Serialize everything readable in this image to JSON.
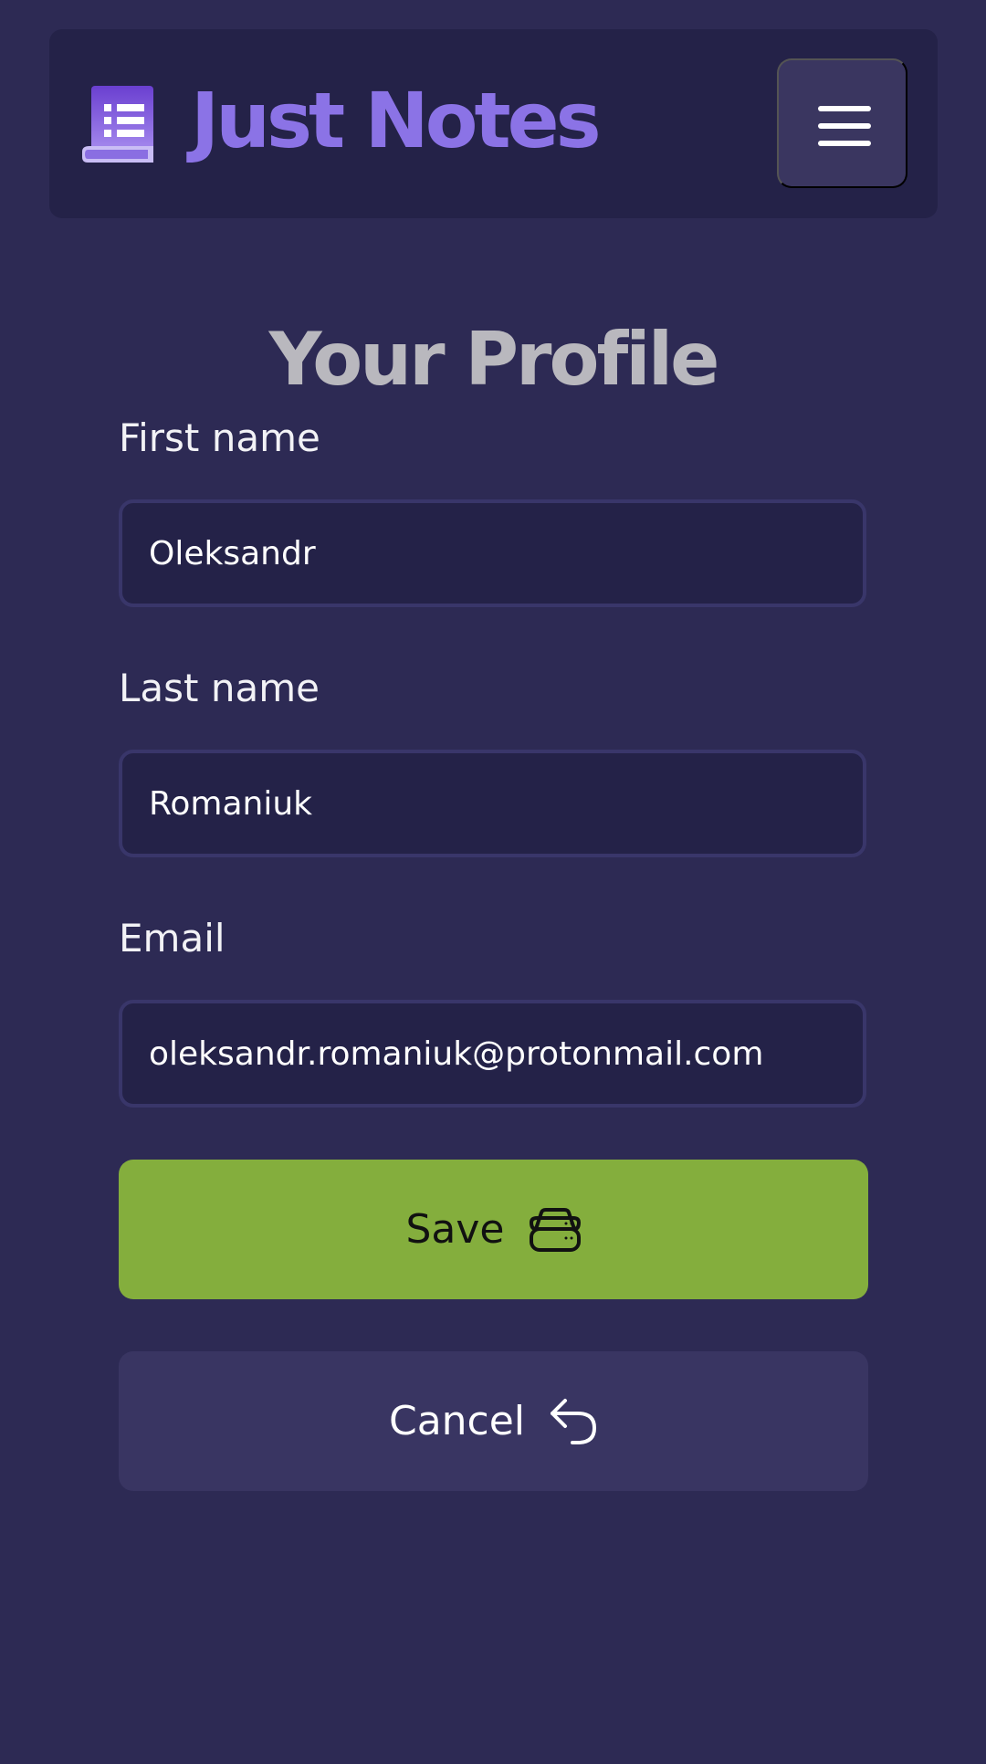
{
  "header": {
    "brand": "Just Notes",
    "logo_icon": "notes-book-icon",
    "menu_icon": "hamburger-menu-icon"
  },
  "page": {
    "title": "Your Profile"
  },
  "form": {
    "first_name": {
      "label": "First name",
      "value": "Oleksandr"
    },
    "last_name": {
      "label": "Last name",
      "value": "Romaniuk"
    },
    "email": {
      "label": "Email",
      "value": "oleksandr.romaniuk@protonmail.com"
    },
    "save_button": {
      "label": "Save",
      "icon": "database-icon"
    },
    "cancel_button": {
      "label": "Cancel",
      "icon": "undo-arrow-icon"
    }
  },
  "colors": {
    "background": "#2d2a54",
    "navbar": "#242248",
    "brand": "#8b73e6",
    "save": "#84ae3d",
    "cancel": "#393562"
  }
}
